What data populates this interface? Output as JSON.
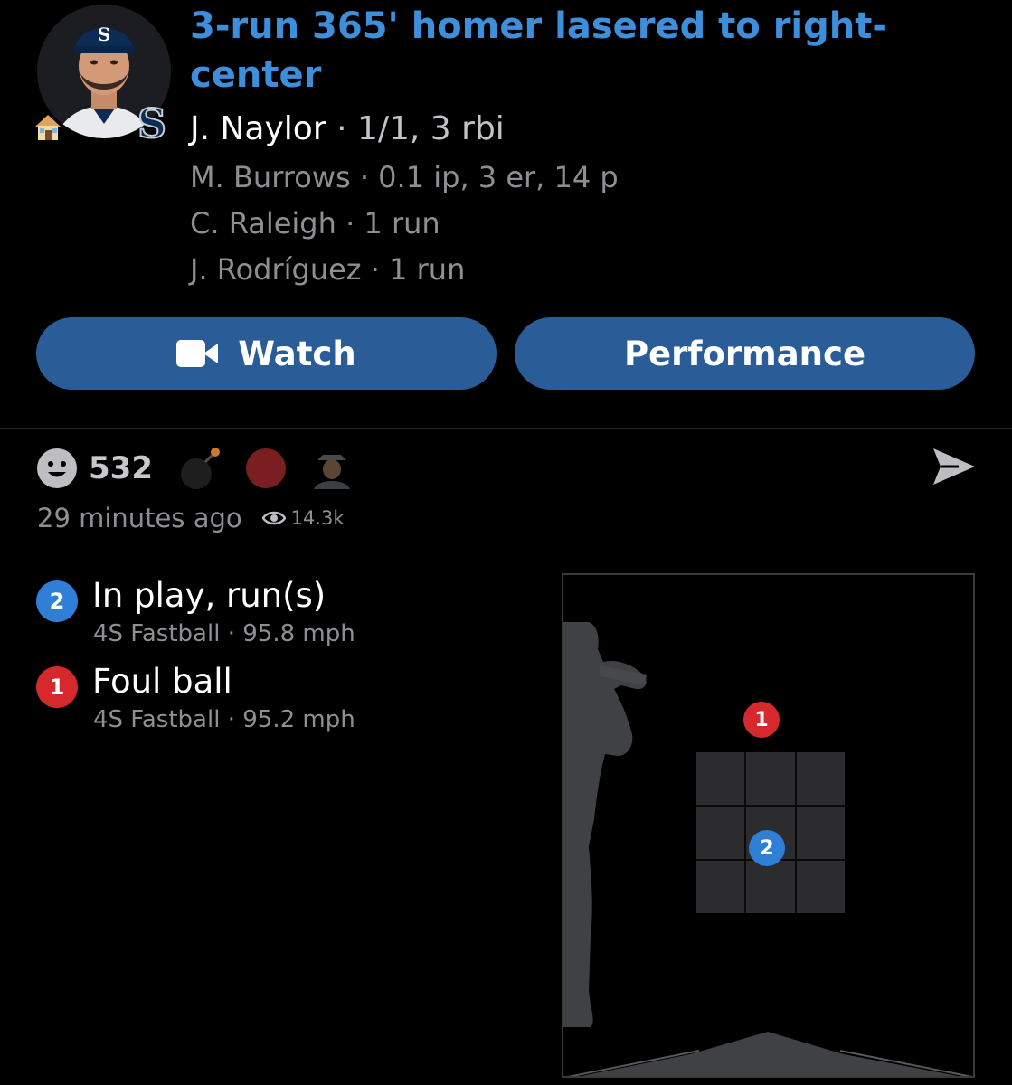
{
  "play": {
    "title": "3-run 365' homer lasered to right-center",
    "batter_name": "J. Naylor",
    "batter_stat": "1/1, 3 rbi",
    "lines": [
      {
        "name": "M. Burrows",
        "stat": "0.1 ip, 3 er, 14 p"
      },
      {
        "name": "C. Raleigh",
        "stat": "1 run"
      },
      {
        "name": "J. Rodríguez",
        "stat": "1 run"
      }
    ],
    "separator": " · "
  },
  "buttons": {
    "watch_label": "Watch",
    "performance_label": "Performance"
  },
  "reactions": {
    "count": "532",
    "time_ago": "29 minutes ago",
    "views": "14.3k"
  },
  "pitches": [
    {
      "number": "2",
      "result": "In play, run(s)",
      "pitch_type": "4S Fastball",
      "speed": "95.8 mph",
      "color": "#2f7fd6"
    },
    {
      "number": "1",
      "result": "Foul ball",
      "pitch_type": "4S Fastball",
      "speed": "95.2 mph",
      "color": "#d6292e"
    }
  ],
  "zone_markers": [
    {
      "number": "1",
      "color": "#d6292e"
    },
    {
      "number": "2",
      "color": "#2f7fd6"
    }
  ],
  "colors": {
    "accent": "#3e8fdb",
    "button": "#2a5d97",
    "ball_in_play": "#2f7fd6",
    "strike": "#d6292e"
  }
}
